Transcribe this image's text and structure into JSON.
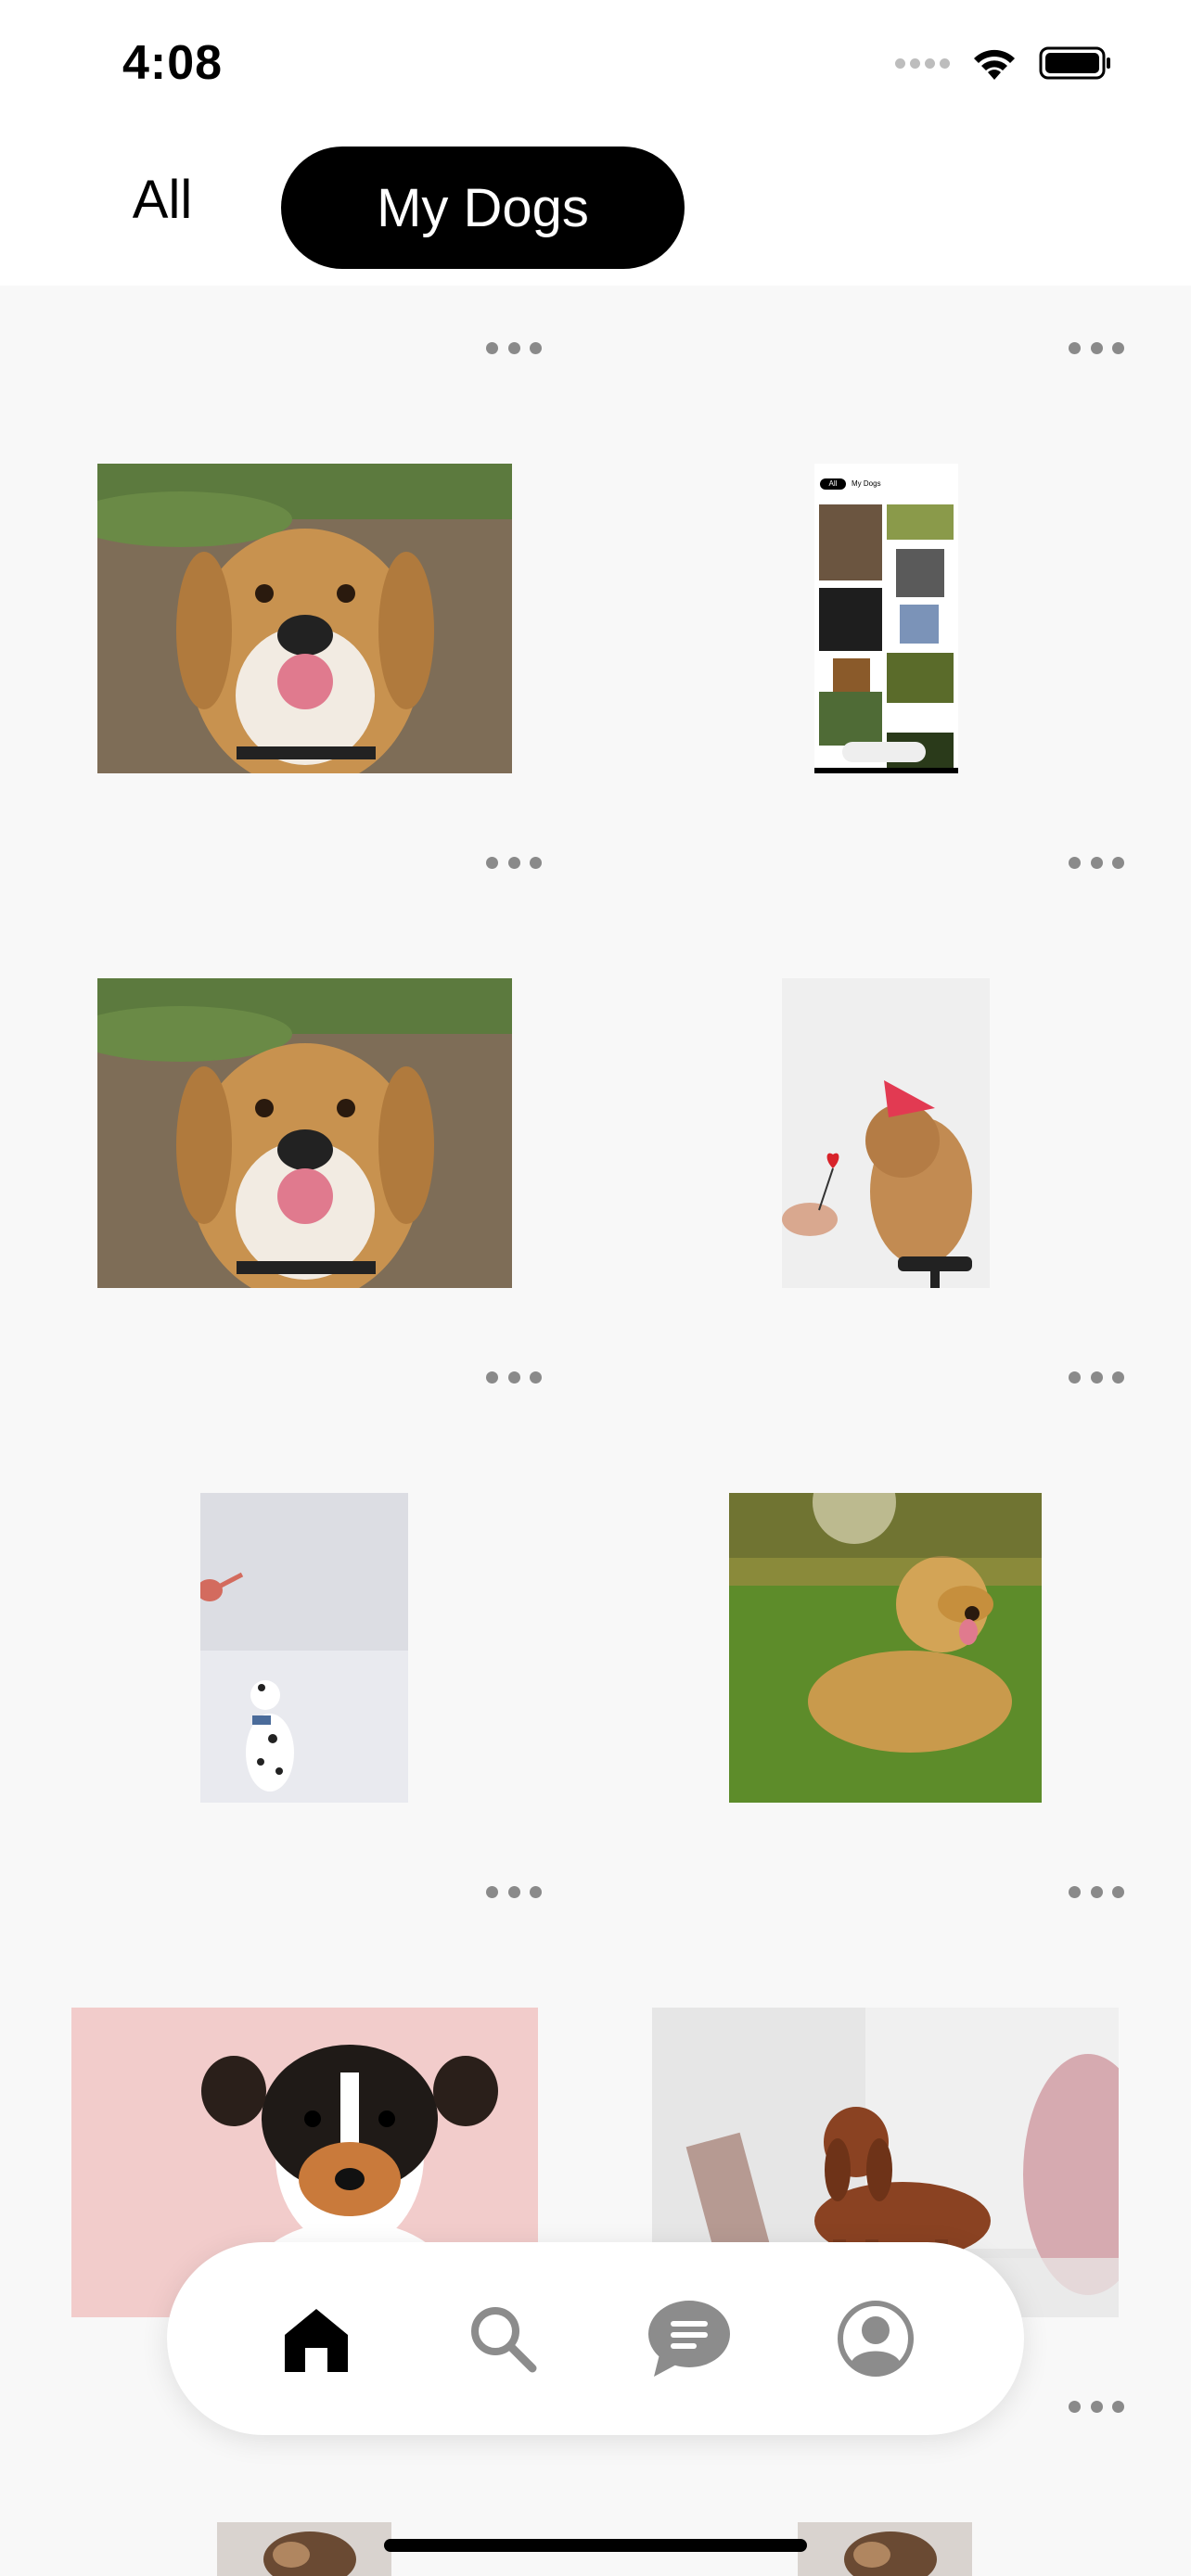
{
  "status_bar": {
    "time": "4:08"
  },
  "tabs": {
    "all_label": "All",
    "mydogs_label": "My Dogs",
    "selected": "My Dogs"
  },
  "feed": {
    "items": [
      {
        "id": 1,
        "subject": "beagle"
      },
      {
        "id": 2,
        "subject": "app screenshot"
      },
      {
        "id": 3,
        "subject": "beagle"
      },
      {
        "id": 4,
        "subject": "shar pei with party hat"
      },
      {
        "id": 5,
        "subject": "dalmatian"
      },
      {
        "id": 6,
        "subject": "golden retriever"
      },
      {
        "id": 7,
        "subject": "jack russell terrier"
      },
      {
        "id": 8,
        "subject": "dachshund"
      }
    ],
    "screenshot_thumb": {
      "tab_all": "All",
      "tab_mydogs": "My Dogs"
    }
  },
  "nav": {
    "items": [
      "home-icon",
      "search-icon",
      "chat-icon",
      "profile-icon"
    ],
    "active": "home-icon"
  },
  "colors": {
    "accent": "#000000",
    "background": "#f8f8f8",
    "inactive_icon": "#8c8c8c"
  }
}
